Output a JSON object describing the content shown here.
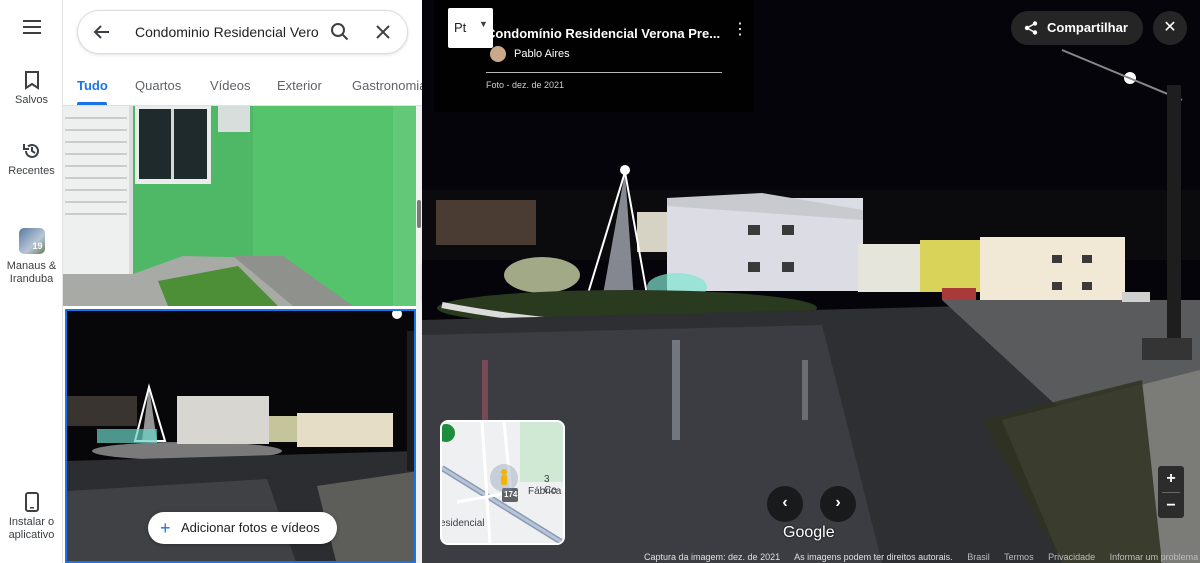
{
  "rail": {
    "saved_label": "Salvos",
    "recent_label": "Recentes",
    "place_label_line1": "Manaus &",
    "place_label_line2": "Iranduba",
    "place_badge": "19",
    "install_label_line1": "Instalar o",
    "install_label_line2": "aplicativo"
  },
  "search": {
    "value": "Condominio Residencial Verona"
  },
  "tabs": [
    {
      "label": "Tudo"
    },
    {
      "label": "Quartos"
    },
    {
      "label": "Vídeos"
    },
    {
      "label": "Exterior"
    },
    {
      "label": "Gastronomia"
    }
  ],
  "panel": {
    "add_photos_label": "Adicionar fotos e vídeos"
  },
  "viewer": {
    "pano_label": "Pt",
    "title": "Condomínio Residencial Verona Pre...",
    "author": "Pablo Aires",
    "date": "Foto - dez. de 2021",
    "share_label": "Compartilhar",
    "brand": "Google",
    "minimap_label1": "3 Co",
    "minimap_label2": "Fábrica",
    "minimap_label3": "esidencial",
    "minimap_road": "174"
  },
  "footer": {
    "capture": "Captura da imagem: dez. de 2021",
    "rights": "As imagens podem ter direitos autorais.",
    "country": "Brasil",
    "terms": "Termos",
    "privacy": "Privacidade",
    "report": "Informar um problema"
  },
  "colors": {
    "accent": "#1a73e8",
    "rail_bg": "#ffffff",
    "wall_green": "#4dba66"
  }
}
